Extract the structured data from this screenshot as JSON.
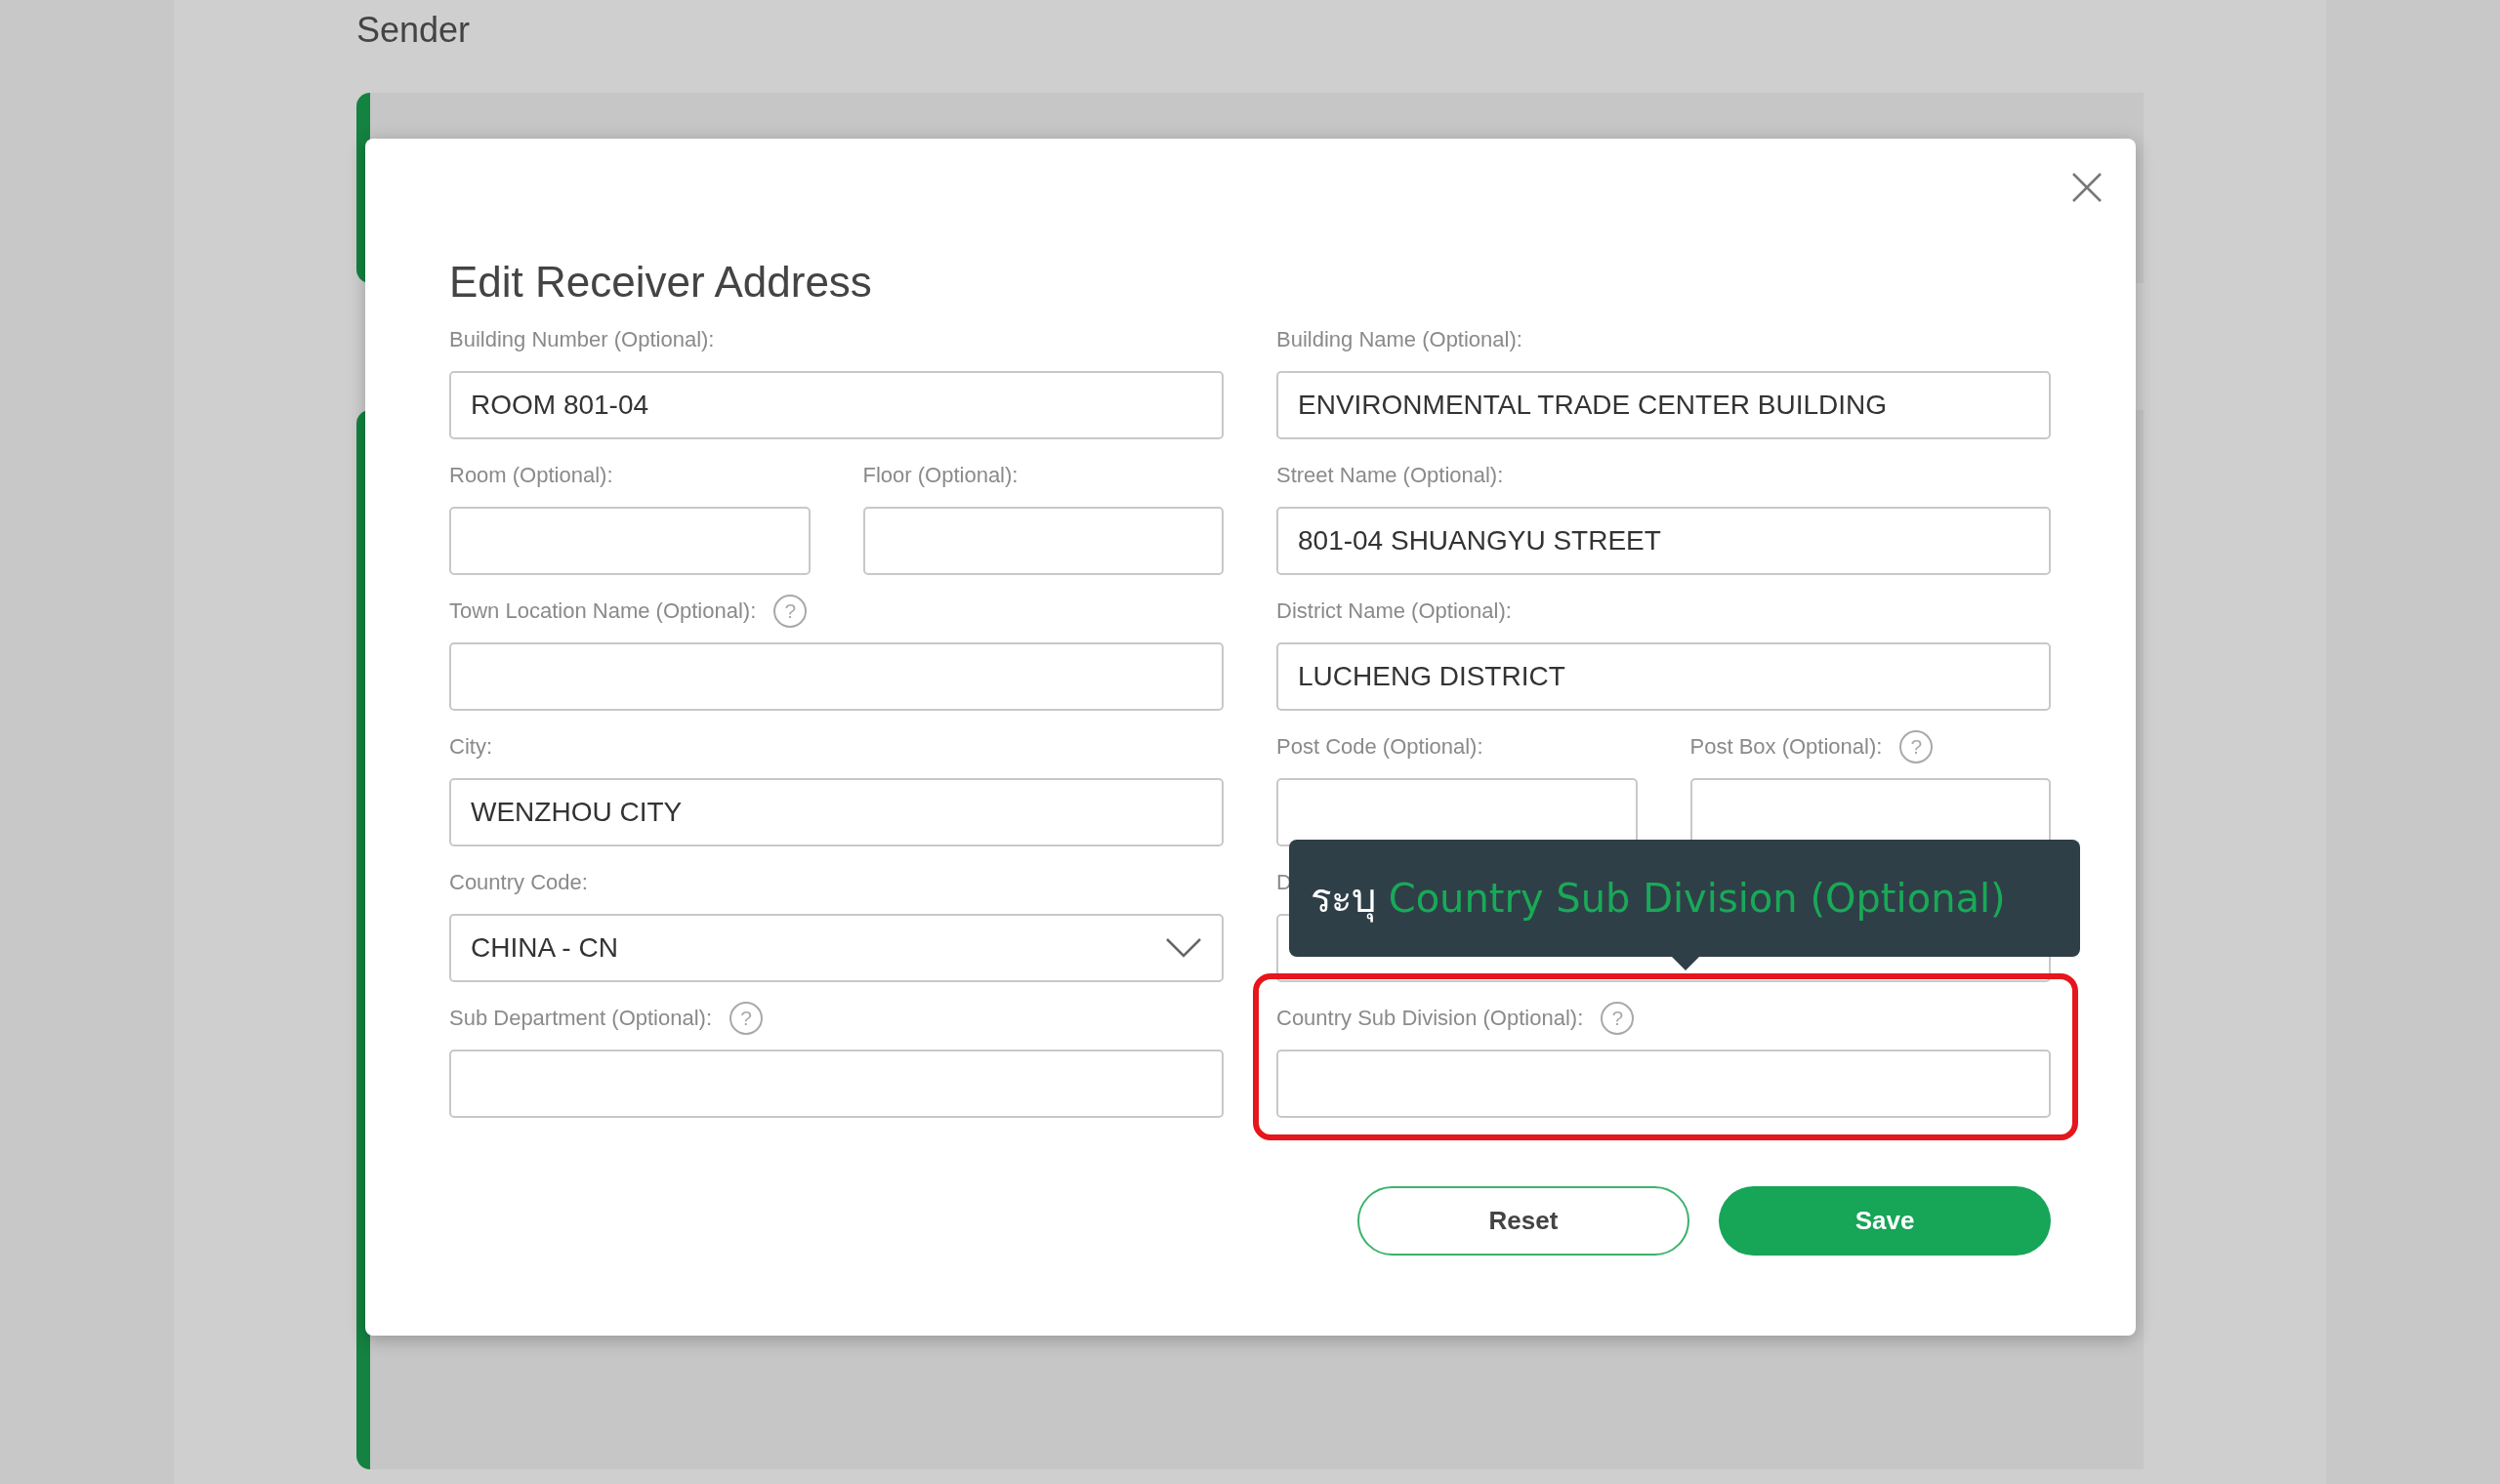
{
  "background": {
    "heading": "Sender"
  },
  "dialog": {
    "title": "Edit Receiver Address",
    "rows": [
      [
        [
          {
            "label": "Building Number (Optional):",
            "value": "ROOM 801-04",
            "kind": "text"
          }
        ],
        [
          {
            "label": "Building Name (Optional):",
            "value": "ENVIRONMENTAL TRADE CENTER BUILDING",
            "kind": "text"
          }
        ]
      ],
      [
        [
          {
            "label": "Room (Optional):",
            "kind": "text"
          },
          {
            "label": "Floor (Optional):",
            "kind": "text"
          }
        ],
        [
          {
            "label": "Street Name (Optional):",
            "value": "801-04 SHUANGYU STREET",
            "kind": "text"
          }
        ]
      ],
      [
        [
          {
            "label": "Town Location Name (Optional):",
            "help": "?",
            "kind": "text"
          }
        ],
        [
          {
            "label": "District Name (Optional):",
            "value": "LUCHENG DISTRICT",
            "kind": "text"
          }
        ]
      ],
      [
        [
          {
            "label": "City:",
            "value": "WENZHOU CITY",
            "kind": "text"
          }
        ],
        [
          {
            "label": "Post Code (Optional):",
            "kind": "text"
          },
          {
            "label": "Post Box (Optional):",
            "help": "?",
            "kind": "text"
          }
        ]
      ],
      [
        [
          {
            "label": "Country Code:",
            "value": "CHINA - CN",
            "kind": "select"
          }
        ],
        [
          {
            "label": "D",
            "kind": "text"
          }
        ]
      ],
      [
        [
          {
            "label": "Sub Department (Optional):",
            "help": "?",
            "kind": "text"
          }
        ],
        [
          {
            "label": "Country Sub Division (Optional):",
            "help": "?",
            "kind": "text",
            "highlighted": true,
            "tooltip": {
              "prefix": "ระบุ",
              "text": "Country Sub Division (Optional)"
            }
          }
        ]
      ]
    ],
    "buttons": [
      {
        "label": "Reset",
        "kind": "secondary"
      },
      {
        "label": "Save",
        "kind": "primary"
      }
    ]
  }
}
